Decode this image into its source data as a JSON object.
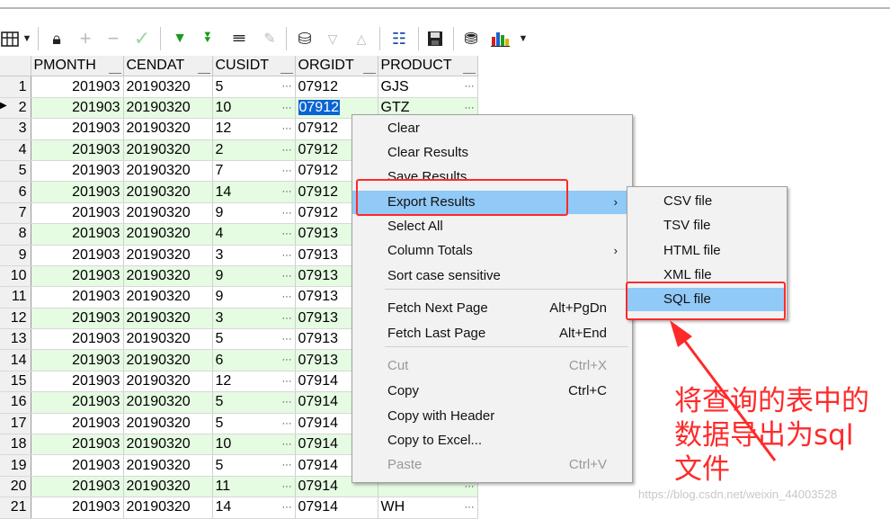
{
  "grid": {
    "columns": [
      "PMONTH",
      "CENDAT",
      "CUSIDT",
      "ORGIDT",
      "PRODUCT"
    ],
    "selected_row": 2,
    "selected_cell_value": "07912",
    "rows": [
      [
        "1",
        "201903",
        "20190320",
        "5",
        "07912",
        "GJS"
      ],
      [
        "2",
        "201903",
        "20190320",
        "10",
        "07912",
        "GTZ"
      ],
      [
        "3",
        "201903",
        "20190320",
        "12",
        "07912",
        ""
      ],
      [
        "4",
        "201903",
        "20190320",
        "2",
        "07912",
        ""
      ],
      [
        "5",
        "201903",
        "20190320",
        "7",
        "07912",
        ""
      ],
      [
        "6",
        "201903",
        "20190320",
        "14",
        "07912",
        ""
      ],
      [
        "7",
        "201903",
        "20190320",
        "9",
        "07912",
        ""
      ],
      [
        "8",
        "201903",
        "20190320",
        "4",
        "07913",
        ""
      ],
      [
        "9",
        "201903",
        "20190320",
        "3",
        "07913",
        ""
      ],
      [
        "10",
        "201903",
        "20190320",
        "9",
        "07913",
        ""
      ],
      [
        "11",
        "201903",
        "20190320",
        "9",
        "07913",
        ""
      ],
      [
        "12",
        "201903",
        "20190320",
        "3",
        "07913",
        ""
      ],
      [
        "13",
        "201903",
        "20190320",
        "5",
        "07913",
        ""
      ],
      [
        "14",
        "201903",
        "20190320",
        "6",
        "07913",
        ""
      ],
      [
        "15",
        "201903",
        "20190320",
        "12",
        "07914",
        ""
      ],
      [
        "16",
        "201903",
        "20190320",
        "5",
        "07914",
        ""
      ],
      [
        "17",
        "201903",
        "20190320",
        "5",
        "07914",
        ""
      ],
      [
        "18",
        "201903",
        "20190320",
        "10",
        "07914",
        ""
      ],
      [
        "19",
        "201903",
        "20190320",
        "5",
        "07914",
        ""
      ],
      [
        "20",
        "201903",
        "20190320",
        "11",
        "07914",
        ""
      ],
      [
        "21",
        "201903",
        "20190320",
        "14",
        "07914",
        "WH"
      ]
    ]
  },
  "context_menu": {
    "items": [
      {
        "label": "Clear"
      },
      {
        "label": "Clear Results"
      },
      {
        "label": "Save Results"
      },
      {
        "label": "Export Results",
        "submenu": true,
        "highlighted": true
      },
      {
        "label": "Select All"
      },
      {
        "label": "Column Totals",
        "submenu": true
      },
      {
        "label": "Sort case sensitive"
      },
      {
        "label": "Fetch Next Page",
        "shortcut": "Alt+PgDn"
      },
      {
        "label": "Fetch Last Page",
        "shortcut": "Alt+End"
      },
      {
        "label": "Cut",
        "shortcut": "Ctrl+X",
        "disabled": true
      },
      {
        "label": "Copy",
        "shortcut": "Ctrl+C"
      },
      {
        "label": "Copy with Header"
      },
      {
        "label": "Copy to Excel..."
      },
      {
        "label": "Paste",
        "shortcut": "Ctrl+V",
        "disabled": true
      }
    ]
  },
  "export_submenu": {
    "items": [
      {
        "label": "CSV file"
      },
      {
        "label": "TSV file"
      },
      {
        "label": "HTML file"
      },
      {
        "label": "XML file"
      },
      {
        "label": "SQL file",
        "highlighted": true
      }
    ]
  },
  "annotation": {
    "line1": "将查询的表中的",
    "line2": "数据导出为sql",
    "line3": "文件",
    "color": "#ff2a2a"
  },
  "watermark": "https://blog.csdn.net/weixin_44003528",
  "toolbar_icons": [
    "grid-layout-icon",
    "dropdown-arrow-icon",
    "lock-icon",
    "plus-icon",
    "minus-icon",
    "check-icon",
    "fetch-next-icon",
    "fetch-last-icon",
    "binoculars-icon",
    "eraser-icon",
    "query-by-example-icon",
    "sort-down-icon",
    "sort-up-icon",
    "tree-icon",
    "save-icon",
    "export-icon",
    "chart-icon",
    "chart-dropdown-icon"
  ]
}
